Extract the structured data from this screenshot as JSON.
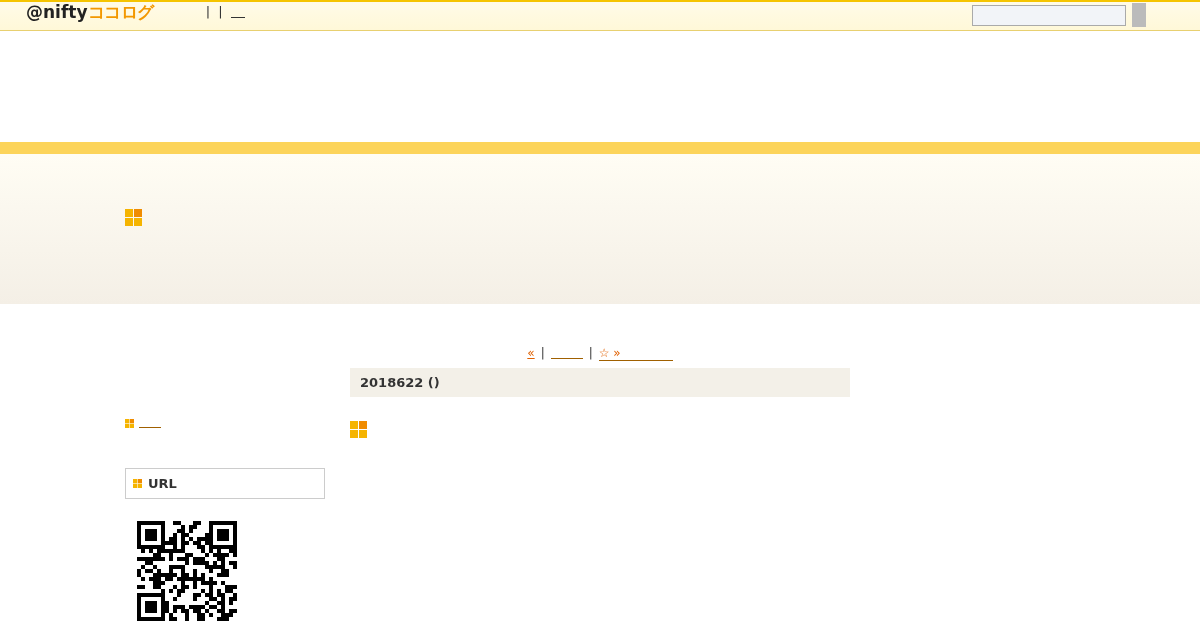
{
  "header": {
    "logo": {
      "brand": "@nifty",
      "product": "ココログ"
    },
    "separators": [
      "|",
      "|"
    ]
  },
  "nav": {
    "prev": "«",
    "separators": [
      "|",
      "|"
    ],
    "next": "☆ »"
  },
  "post": {
    "date": "2018622 ()"
  },
  "sidebar": {
    "url_title": "URL"
  }
}
